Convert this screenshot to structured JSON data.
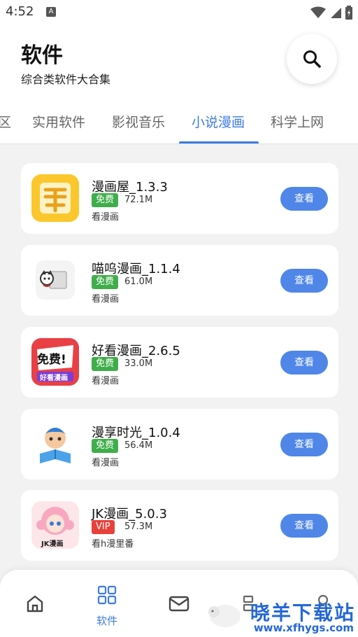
{
  "status": {
    "time": "4:52",
    "notif_letter": "A"
  },
  "header": {
    "title": "软件",
    "subtitle": "综合类软件大合集"
  },
  "tabs": [
    {
      "label": "区"
    },
    {
      "label": "实用软件"
    },
    {
      "label": "影视音乐"
    },
    {
      "label": "小说漫画",
      "active": true
    },
    {
      "label": "科学上网"
    }
  ],
  "apps": [
    {
      "name": "漫画屋_1.3.3",
      "badge": "免费",
      "size": "72.1M",
      "desc": "看漫画",
      "button": "查看",
      "icon": "manhua-wu-icon"
    },
    {
      "name": "喵呜漫画_1.1.4",
      "badge": "免费",
      "size": "61.0M",
      "desc": "看漫画",
      "button": "查看",
      "icon": "miaowu-icon"
    },
    {
      "name": "好看漫画_2.6.5",
      "badge": "免费",
      "size": "33.0M",
      "desc": "看漫画",
      "button": "查看",
      "icon": "haokan-icon",
      "icon_text": "免费!",
      "icon_subtext": "好看漫画"
    },
    {
      "name": "漫享时光_1.0.4",
      "badge": "免费",
      "size": "56.4M",
      "desc": "看漫画",
      "button": "查看",
      "icon": "manxiang-icon"
    },
    {
      "name": "JK漫画_5.0.3",
      "badge": "VIP",
      "size": "57.3M",
      "desc": "看h漫里番",
      "button": "查看",
      "icon": "jk-icon",
      "icon_text": "JK漫画"
    }
  ],
  "bottom_nav": {
    "active_label": "软件"
  },
  "watermark": {
    "main": "晓羊下载站",
    "url": "www.xfhygs.com"
  },
  "colors": {
    "accent": "#3d7be0",
    "free_badge": "#3fae4a",
    "vip_badge": "#e8413b",
    "button": "#4f86e8"
  }
}
